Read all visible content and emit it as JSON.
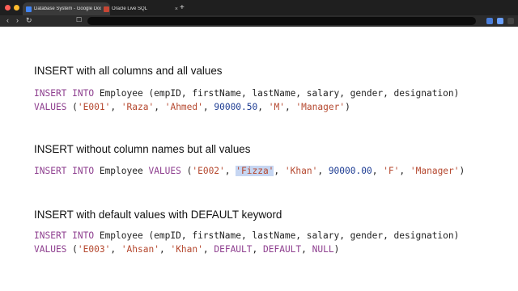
{
  "browser": {
    "tabs": [
      {
        "title": "Database System - Google Docs",
        "favicon_color": "#4285f4",
        "active": true
      },
      {
        "title": "Oracle Live SQL",
        "favicon_color": "#c74634",
        "active": false
      }
    ],
    "new_tab_label": "+",
    "close_label": "×",
    "nav": {
      "back": "‹",
      "forward": "›",
      "reload": "↻",
      "bookmark": "☐"
    }
  },
  "colors": {
    "keyword": "#8e3f8f",
    "string": "#b5482f",
    "number": "#1d3c93",
    "highlight": "#c6d6f2"
  },
  "sections": [
    {
      "heading": "INSERT with all columns and all values",
      "lines": [
        [
          {
            "t": "INSERT INTO",
            "c": "kw"
          },
          {
            "t": " Employee (empID, firstName, lastName, salary, gender, designation)",
            "c": ""
          }
        ],
        [
          {
            "t": "VALUES",
            "c": "kw"
          },
          {
            "t": " (",
            "c": ""
          },
          {
            "t": "'E001'",
            "c": "str"
          },
          {
            "t": ", ",
            "c": ""
          },
          {
            "t": "'Raza'",
            "c": "str"
          },
          {
            "t": ", ",
            "c": ""
          },
          {
            "t": "'Ahmed'",
            "c": "str"
          },
          {
            "t": ", ",
            "c": ""
          },
          {
            "t": "90000.50",
            "c": "num"
          },
          {
            "t": ", ",
            "c": ""
          },
          {
            "t": "'M'",
            "c": "str"
          },
          {
            "t": ", ",
            "c": ""
          },
          {
            "t": "'Manager'",
            "c": "str"
          },
          {
            "t": ")",
            "c": ""
          }
        ]
      ]
    },
    {
      "heading": "INSERT without column names but all values",
      "lines": [
        [
          {
            "t": "INSERT INTO",
            "c": "kw"
          },
          {
            "t": " Employee ",
            "c": ""
          },
          {
            "t": "VALUES",
            "c": "kw"
          },
          {
            "t": " (",
            "c": ""
          },
          {
            "t": "'E002'",
            "c": "str"
          },
          {
            "t": ", ",
            "c": ""
          },
          {
            "t": "'Fizza'",
            "c": "str hl"
          },
          {
            "t": ", ",
            "c": ""
          },
          {
            "t": "'Khan'",
            "c": "str"
          },
          {
            "t": ", ",
            "c": ""
          },
          {
            "t": "90000.00",
            "c": "num"
          },
          {
            "t": ", ",
            "c": ""
          },
          {
            "t": "'F'",
            "c": "str"
          },
          {
            "t": ", ",
            "c": ""
          },
          {
            "t": "'Manager'",
            "c": "str"
          },
          {
            "t": ")",
            "c": ""
          }
        ]
      ]
    },
    {
      "heading": "INSERT with default values with DEFAULT keyword",
      "lines": [
        [
          {
            "t": "INSERT INTO",
            "c": "kw"
          },
          {
            "t": " Employee (empID, firstName, lastName, salary, gender, designation)",
            "c": ""
          }
        ],
        [
          {
            "t": "VALUES",
            "c": "kw"
          },
          {
            "t": " (",
            "c": ""
          },
          {
            "t": "'E003'",
            "c": "str"
          },
          {
            "t": ", ",
            "c": ""
          },
          {
            "t": "'Ahsan'",
            "c": "str"
          },
          {
            "t": ", ",
            "c": ""
          },
          {
            "t": "'Khan'",
            "c": "str"
          },
          {
            "t": ", ",
            "c": ""
          },
          {
            "t": "DEFAULT",
            "c": "kw"
          },
          {
            "t": ", ",
            "c": ""
          },
          {
            "t": "DEFAULT",
            "c": "kw"
          },
          {
            "t": ", ",
            "c": ""
          },
          {
            "t": "NULL",
            "c": "kw"
          },
          {
            "t": ")",
            "c": ""
          }
        ]
      ]
    }
  ]
}
